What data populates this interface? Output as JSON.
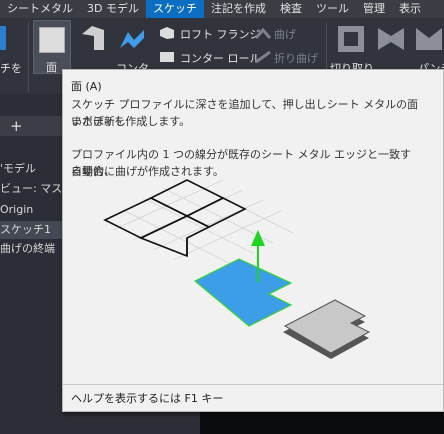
{
  "menu": {
    "tabs": [
      "シートメタル",
      "3D モデル",
      "スケッチ",
      "注記を作成",
      "検査",
      "ツール",
      "管理",
      "表示"
    ]
  },
  "ribbon": {
    "create_sketch_fragment": "チを",
    "face_label": "面",
    "contour_label": "コンタ",
    "flange_label": "ロフト フランジ",
    "contour_roll_label": "コンター ロール",
    "bend_label": "曲げ",
    "fold_label": "折り曲げ",
    "unfold_fragment": "切り取り",
    "punch_fragment": "パンチ"
  },
  "browser": {
    "rows": [
      "'モデル",
      "ビュー: マス",
      "Origin",
      "スケッチ1",
      "曲げの終端"
    ]
  },
  "tooltip": {
    "title": "面 (A)",
    "description_line1": "スケッチ プロファイルに深さを追加して、押し出しシート メタルの面または新し",
    "description_line2": "いボディを作成します。",
    "note_line1": "プロファイル内の 1 つの線分が既存のシート メタル エッジと一致する場合、",
    "note_line2": "自動的に曲げが作成されます。",
    "help": "ヘルプを表示するには F1 キー"
  },
  "colors": {
    "accent": "#0b6ec2",
    "face_fill": "#3d9ee8",
    "face_edge": "#38d23a",
    "arrow": "#1fd51f",
    "result_fill": "#c8c8c8"
  }
}
